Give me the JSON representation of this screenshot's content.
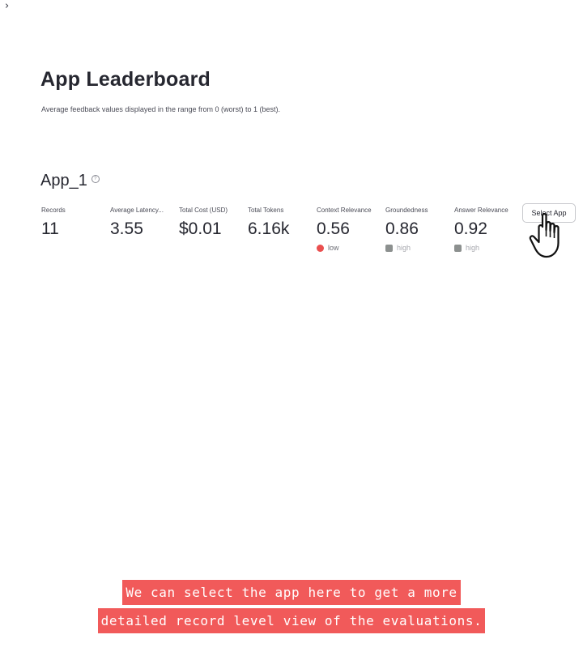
{
  "sidebar": {
    "toggle_glyph": "›"
  },
  "header": {
    "title": "App Leaderboard",
    "subtitle": "Average feedback values displayed in the range from 0 (worst) to 1 (best)."
  },
  "app": {
    "name": "App_1",
    "help_glyph": "?",
    "metrics": [
      {
        "label": "Records",
        "value": "11"
      },
      {
        "label": "Average Latency...",
        "value": "3.55"
      },
      {
        "label": "Total Cost (USD)",
        "value": "$0.01"
      },
      {
        "label": "Total Tokens",
        "value": "6.16k"
      },
      {
        "label": "Context Relevance",
        "value": "0.56",
        "delta": "low",
        "delta_color": "#ea4f4f"
      },
      {
        "label": "Groundedness",
        "value": "0.86",
        "delta": "high",
        "delta_color": "#8c908f"
      },
      {
        "label": "Answer Relevance",
        "value": "0.92",
        "delta": "high",
        "delta_color": "#8c908f"
      }
    ],
    "select_button_label": "Select App"
  },
  "caption": {
    "line1": "We can select the app here to get a more",
    "line2": "detailed record level view of the evaluations."
  },
  "icons": {
    "cursor": "pointing-hand-icon",
    "help": "help-circle-icon"
  }
}
